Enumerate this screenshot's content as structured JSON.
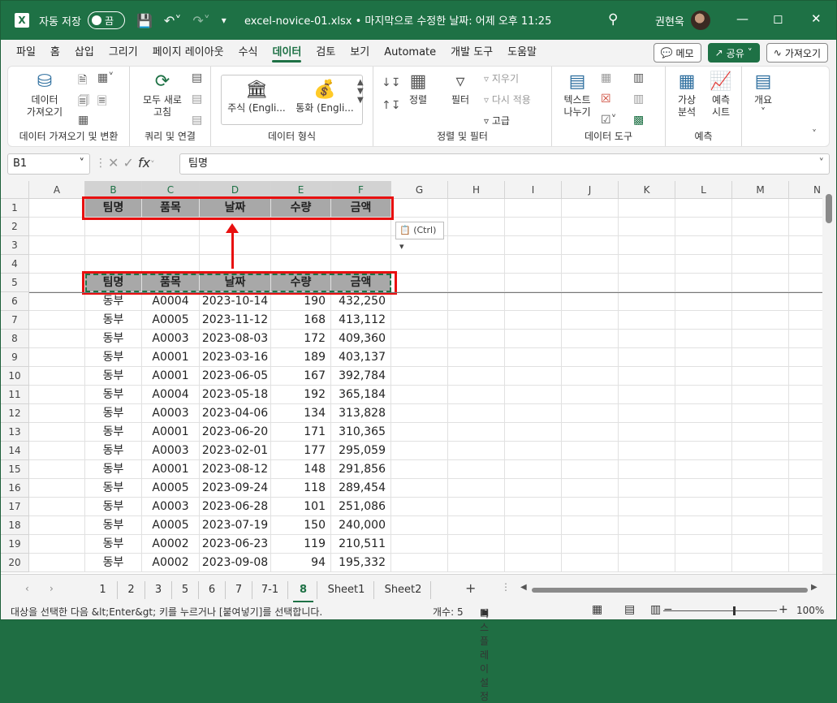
{
  "titlebar": {
    "autosave_label": "자동 저장",
    "autosave_state": "끔",
    "file_title": "excel-novice-01.xlsx • 마지막으로 수정한 날짜: 어제 오후 11:25",
    "user_name": "권현욱"
  },
  "menu": {
    "items": [
      "파일",
      "홈",
      "삽입",
      "그리기",
      "페이지 레이아웃",
      "수식",
      "데이터",
      "검토",
      "보기",
      "Automate",
      "개발 도구",
      "도움말"
    ],
    "active": "데이터",
    "memo": "메모",
    "share": "공유",
    "import": "가져오기"
  },
  "ribbon": {
    "get_data": "데이터\n가져오기",
    "group_get": "데이터 가져오기 및 변환",
    "refresh_all": "모두 새로\n고침",
    "group_query": "쿼리 및 연결",
    "stock": "주식 (Engli...",
    "currency": "통화 (Engli...",
    "group_types": "데이터 형식",
    "sort": "정렬",
    "filter": "필터",
    "clear": "지우기",
    "reapply": "다시 적용",
    "advanced": "고급",
    "group_sort": "정렬 및 필터",
    "text_to_columns": "텍스트\n나누기",
    "group_tools": "데이터 도구",
    "what_if": "가상\n분석",
    "forecast": "예측\n시트",
    "group_forecast": "예측",
    "outline": "개요"
  },
  "formula_bar": {
    "name_box": "B1",
    "formula": "팀명"
  },
  "grid": {
    "columns": [
      "A",
      "B",
      "C",
      "D",
      "E",
      "F",
      "G",
      "H",
      "I",
      "J",
      "K",
      "L",
      "M",
      "N"
    ],
    "headers": [
      "팀명",
      "품목",
      "날짜",
      "수량",
      "금액"
    ],
    "rows": [
      [
        "동부",
        "A0004",
        "2023-10-14",
        "190",
        "432,250"
      ],
      [
        "동부",
        "A0005",
        "2023-11-12",
        "168",
        "413,112"
      ],
      [
        "동부",
        "A0003",
        "2023-08-03",
        "172",
        "409,360"
      ],
      [
        "동부",
        "A0001",
        "2023-03-16",
        "189",
        "403,137"
      ],
      [
        "동부",
        "A0001",
        "2023-06-05",
        "167",
        "392,784"
      ],
      [
        "동부",
        "A0004",
        "2023-05-18",
        "192",
        "365,184"
      ],
      [
        "동부",
        "A0003",
        "2023-04-06",
        "134",
        "313,828"
      ],
      [
        "동부",
        "A0001",
        "2023-06-20",
        "171",
        "310,365"
      ],
      [
        "동부",
        "A0003",
        "2023-02-01",
        "177",
        "295,059"
      ],
      [
        "동부",
        "A0001",
        "2023-08-12",
        "148",
        "291,856"
      ],
      [
        "동부",
        "A0005",
        "2023-09-24",
        "118",
        "289,454"
      ],
      [
        "동부",
        "A0003",
        "2023-06-28",
        "101",
        "251,086"
      ],
      [
        "동부",
        "A0005",
        "2023-07-19",
        "150",
        "240,000"
      ],
      [
        "동부",
        "A0002",
        "2023-06-23",
        "119",
        "210,511"
      ],
      [
        "동부",
        "A0002",
        "2023-09-08",
        "94",
        "195,332"
      ]
    ],
    "paste_options": "(Ctrl)"
  },
  "sheet_tabs": [
    "1",
    "2",
    "3",
    "5",
    "6",
    "7",
    "7-1",
    "8",
    "Sheet1",
    "Sheet2"
  ],
  "active_tab": "8",
  "status": {
    "message": "대상을 선택한 다음 &lt;Enter&gt; 키를 누르거나 [붙여넣기]를 선택합니다.",
    "count": "개수: 5",
    "display_settings": "디스플레이 설정",
    "zoom": "100%"
  },
  "colors": {
    "accent": "#1e7145",
    "highlight": "#e81010"
  }
}
